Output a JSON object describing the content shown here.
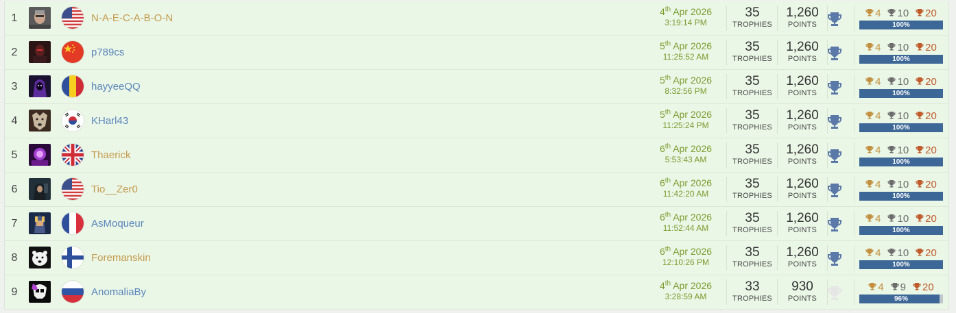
{
  "colors": {
    "gold_name": "#c49a4c",
    "blue_name": "#5a86bb",
    "date": "#7a9c2e",
    "progress_fill": "#3d6796",
    "cup_active": "#5b79a8",
    "cup_inactive": "#e6e6e6"
  },
  "rows": [
    {
      "rank": "1",
      "avatar": "avatar-man-photo",
      "flag": "flag-usa",
      "name": "N-A-E-C-A-B-O-N",
      "name_color": "gold",
      "day": "4",
      "suffix": "th",
      "date_rest": " Apr 2026",
      "time": "3:19:14 PM",
      "trophies": "35",
      "trophies_label": "TROPHIES",
      "points": "1,260",
      "points_label": "POINTS",
      "platinum": true,
      "gold": "4",
      "silver": "10",
      "bronze": "20",
      "progress": 100,
      "progress_label": "100%"
    },
    {
      "rank": "2",
      "avatar": "avatar-dark-warrior",
      "flag": "flag-china",
      "name": "p789cs",
      "name_color": "blue",
      "day": "5",
      "suffix": "th",
      "date_rest": " Apr 2026",
      "time": "11:25:52 AM",
      "trophies": "35",
      "trophies_label": "TROPHIES",
      "points": "1,260",
      "points_label": "POINTS",
      "platinum": true,
      "gold": "4",
      "silver": "10",
      "bronze": "20",
      "progress": 100,
      "progress_label": "100%"
    },
    {
      "rank": "3",
      "avatar": "avatar-purple-hood",
      "flag": "flag-romania",
      "name": "hayyeeQQ",
      "name_color": "blue",
      "day": "5",
      "suffix": "th",
      "date_rest": " Apr 2026",
      "time": "8:32:56 PM",
      "trophies": "35",
      "trophies_label": "TROPHIES",
      "points": "1,260",
      "points_label": "POINTS",
      "platinum": true,
      "gold": "4",
      "silver": "10",
      "bronze": "20",
      "progress": 100,
      "progress_label": "100%"
    },
    {
      "rank": "4",
      "avatar": "avatar-wolf",
      "flag": "flag-south-korea",
      "name": "KHarl43",
      "name_color": "blue",
      "day": "5",
      "suffix": "th",
      "date_rest": " Apr 2026",
      "time": "11:25:24 PM",
      "trophies": "35",
      "trophies_label": "TROPHIES",
      "points": "1,260",
      "points_label": "POINTS",
      "platinum": true,
      "gold": "4",
      "silver": "10",
      "bronze": "20",
      "progress": 100,
      "progress_label": "100%"
    },
    {
      "rank": "5",
      "avatar": "avatar-purple-character",
      "flag": "flag-uk",
      "name": "Thaerick",
      "name_color": "gold",
      "day": "6",
      "suffix": "th",
      "date_rest": " Apr 2026",
      "time": "5:53:43 AM",
      "trophies": "35",
      "trophies_label": "TROPHIES",
      "points": "1,260",
      "points_label": "POINTS",
      "platinum": true,
      "gold": "4",
      "silver": "10",
      "bronze": "20",
      "progress": 100,
      "progress_label": "100%"
    },
    {
      "rank": "6",
      "avatar": "avatar-hooded-figure",
      "flag": "flag-usa",
      "name": "Tio__Zer0",
      "name_color": "gold",
      "day": "6",
      "suffix": "th",
      "date_rest": " Apr 2026",
      "time": "11:42:20 AM",
      "trophies": "35",
      "trophies_label": "TROPHIES",
      "points": "1,260",
      "points_label": "POINTS",
      "platinum": true,
      "gold": "4",
      "silver": "10",
      "bronze": "20",
      "progress": 100,
      "progress_label": "100%"
    },
    {
      "rank": "7",
      "avatar": "avatar-knight",
      "flag": "flag-france",
      "name": "AsMoqueur",
      "name_color": "blue",
      "day": "6",
      "suffix": "th",
      "date_rest": " Apr 2026",
      "time": "11:52:44 AM",
      "trophies": "35",
      "trophies_label": "TROPHIES",
      "points": "1,260",
      "points_label": "POINTS",
      "platinum": true,
      "gold": "4",
      "silver": "10",
      "bronze": "20",
      "progress": 100,
      "progress_label": "100%"
    },
    {
      "rank": "8",
      "avatar": "avatar-polar-bear",
      "flag": "flag-finland",
      "name": "Foremanskin",
      "name_color": "gold",
      "day": "6",
      "suffix": "th",
      "date_rest": " Apr 2026",
      "time": "12:10:26 PM",
      "trophies": "35",
      "trophies_label": "TROPHIES",
      "points": "1,260",
      "points_label": "POINTS",
      "platinum": true,
      "gold": "4",
      "silver": "10",
      "bronze": "20",
      "progress": 100,
      "progress_label": "100%"
    },
    {
      "rank": "9",
      "avatar": "avatar-skull-logo",
      "flag": "flag-russia",
      "name": "AnomaliaBy",
      "name_color": "blue",
      "day": "4",
      "suffix": "th",
      "date_rest": " Apr 2026",
      "time": "3:28:59 AM",
      "trophies": "33",
      "trophies_label": "TROPHIES",
      "points": "930",
      "points_label": "POINTS",
      "platinum": false,
      "gold": "4",
      "silver": "9",
      "bronze": "20",
      "progress": 96,
      "progress_label": "96%"
    }
  ]
}
